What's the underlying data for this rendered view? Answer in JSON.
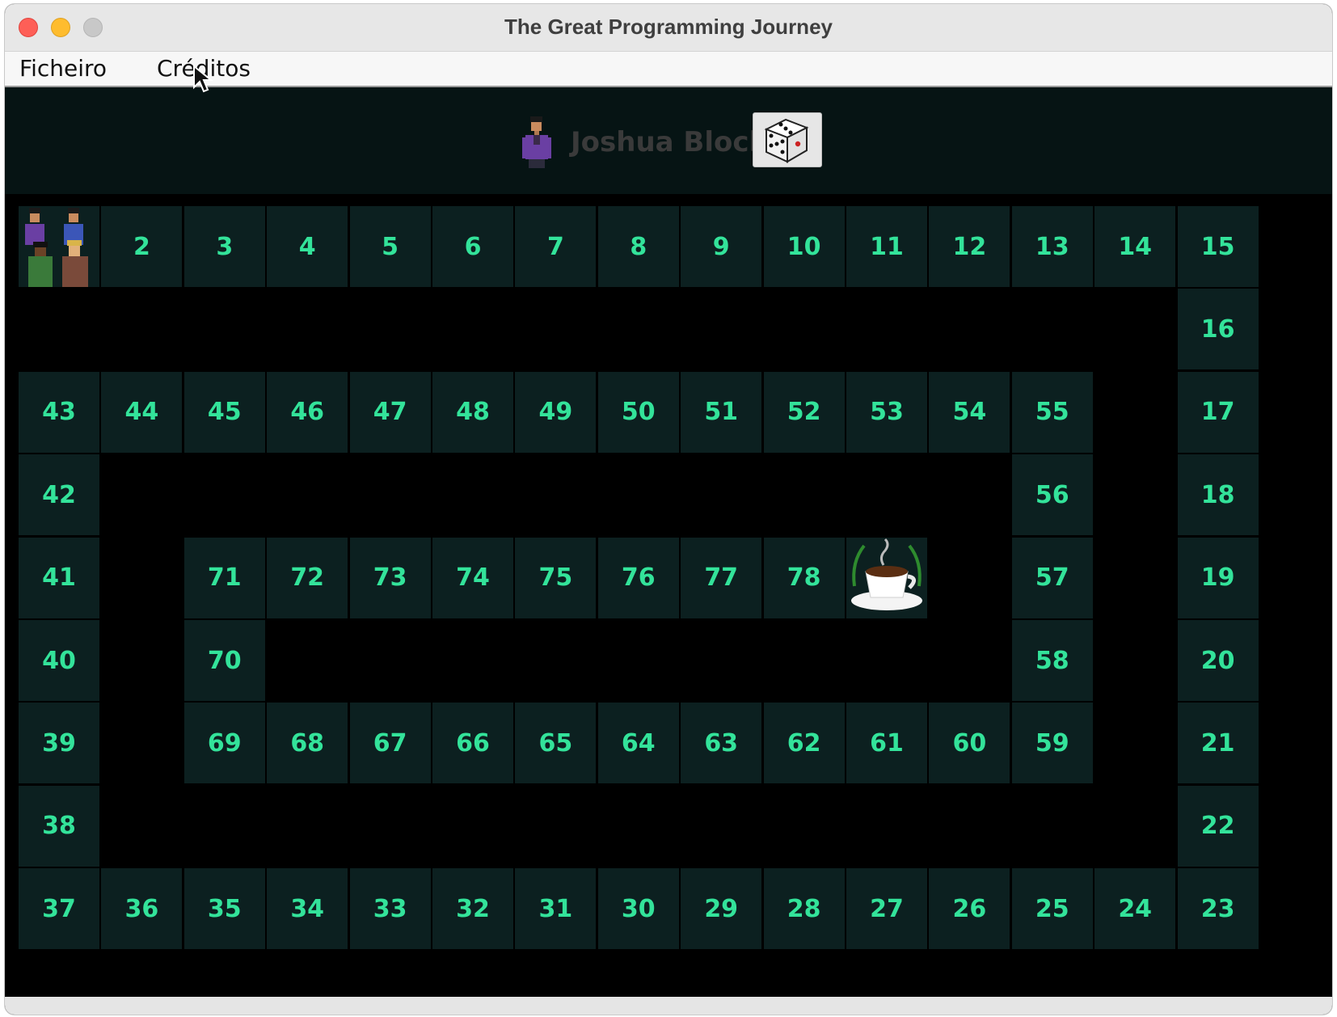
{
  "window": {
    "title": "The Great Programming Journey"
  },
  "menu": {
    "file": "Ficheiro",
    "credits": "Créditos"
  },
  "current_player": {
    "name": "Joshua Bloch"
  },
  "board": {
    "start_cell": 1,
    "finish_cell": 79,
    "cells": [
      {
        "n": "2"
      },
      {
        "n": "3"
      },
      {
        "n": "4"
      },
      {
        "n": "5"
      },
      {
        "n": "6"
      },
      {
        "n": "7"
      },
      {
        "n": "8"
      },
      {
        "n": "9"
      },
      {
        "n": "10"
      },
      {
        "n": "11"
      },
      {
        "n": "12"
      },
      {
        "n": "13"
      },
      {
        "n": "14"
      },
      {
        "n": "15"
      },
      {
        "n": "16"
      },
      {
        "n": "17"
      },
      {
        "n": "18"
      },
      {
        "n": "19"
      },
      {
        "n": "20"
      },
      {
        "n": "21"
      },
      {
        "n": "22"
      },
      {
        "n": "23"
      },
      {
        "n": "24"
      },
      {
        "n": "25"
      },
      {
        "n": "26"
      },
      {
        "n": "27"
      },
      {
        "n": "28"
      },
      {
        "n": "29"
      },
      {
        "n": "30"
      },
      {
        "n": "31"
      },
      {
        "n": "32"
      },
      {
        "n": "33"
      },
      {
        "n": "34"
      },
      {
        "n": "35"
      },
      {
        "n": "36"
      },
      {
        "n": "37"
      },
      {
        "n": "38"
      },
      {
        "n": "39"
      },
      {
        "n": "40"
      },
      {
        "n": "41"
      },
      {
        "n": "42"
      },
      {
        "n": "43"
      },
      {
        "n": "44"
      },
      {
        "n": "45"
      },
      {
        "n": "46"
      },
      {
        "n": "47"
      },
      {
        "n": "48"
      },
      {
        "n": "49"
      },
      {
        "n": "50"
      },
      {
        "n": "51"
      },
      {
        "n": "52"
      },
      {
        "n": "53"
      },
      {
        "n": "54"
      },
      {
        "n": "55"
      },
      {
        "n": "56"
      },
      {
        "n": "57"
      },
      {
        "n": "58"
      },
      {
        "n": "59"
      },
      {
        "n": "60"
      },
      {
        "n": "61"
      },
      {
        "n": "62"
      },
      {
        "n": "63"
      },
      {
        "n": "64"
      },
      {
        "n": "65"
      },
      {
        "n": "66"
      },
      {
        "n": "67"
      },
      {
        "n": "68"
      },
      {
        "n": "69"
      },
      {
        "n": "70"
      },
      {
        "n": "71"
      },
      {
        "n": "72"
      },
      {
        "n": "73"
      },
      {
        "n": "74"
      },
      {
        "n": "75"
      },
      {
        "n": "76"
      },
      {
        "n": "77"
      },
      {
        "n": "78"
      }
    ]
  },
  "colors": {
    "cell_bg": "#0c2020",
    "cell_text": "#33e39a",
    "board_bg": "#000000",
    "header_bg": "#061414"
  },
  "icons": {
    "dice": "dice-icon",
    "start": "players-group-icon",
    "finish": "coffee-cup-icon"
  }
}
